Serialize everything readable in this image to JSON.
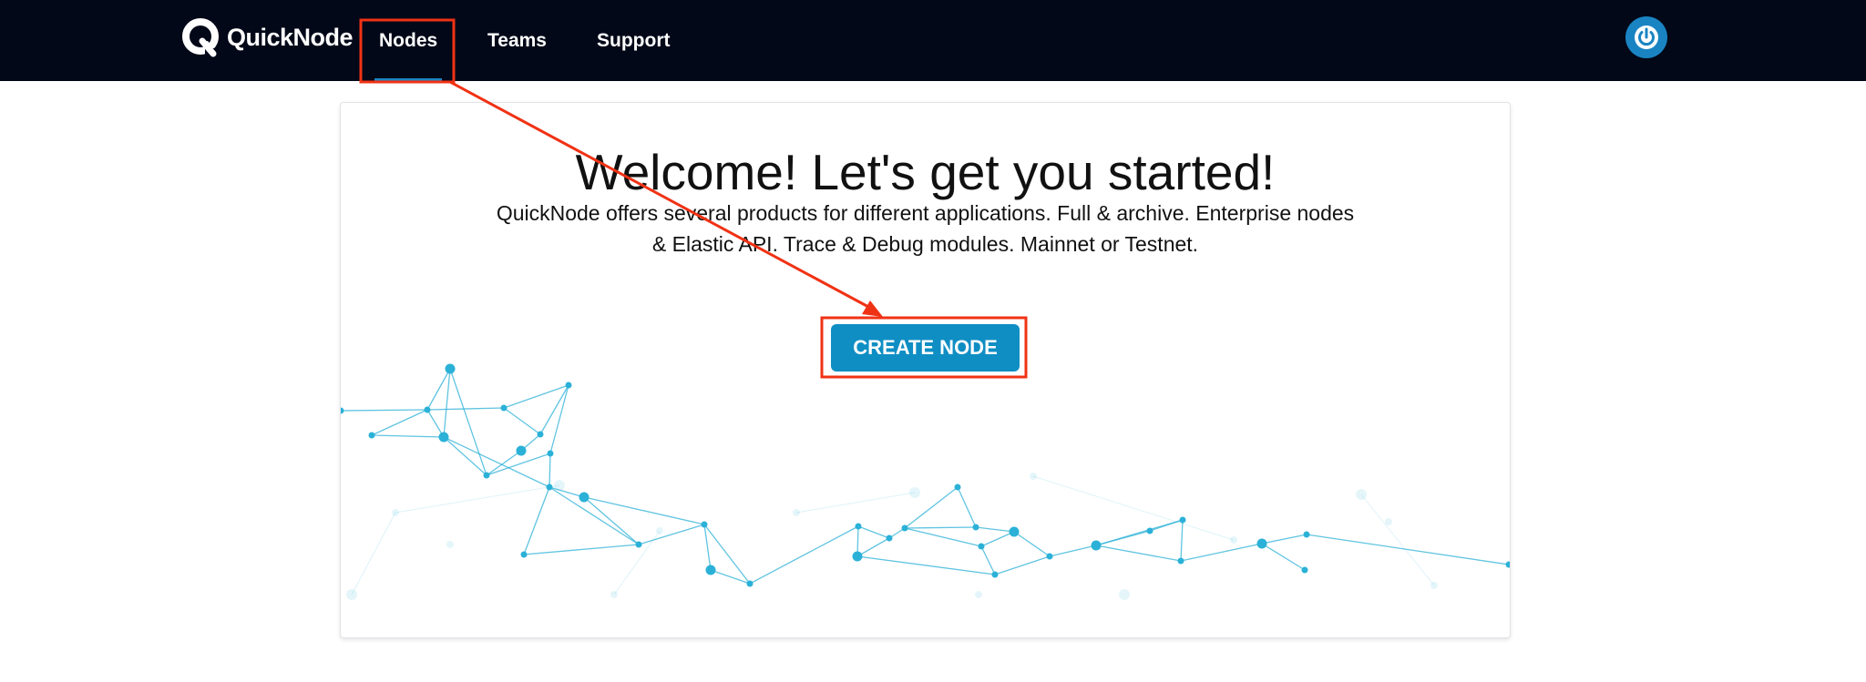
{
  "header": {
    "brand": "QuickNode",
    "nav": [
      {
        "label": "Nodes",
        "active": true
      },
      {
        "label": "Teams"
      },
      {
        "label": "Support"
      }
    ]
  },
  "main": {
    "title": "Welcome! Let's get you started!",
    "description": "QuickNode offers several products for different applications. Full & archive. Enterprise nodes & Elastic API. Trace & Debug modules. Mainnet or Testnet.",
    "cta_label": "CREATE NODE"
  },
  "colors": {
    "navbar_bg": "#020818",
    "accent": "#1a84c3",
    "cta_bg": "#0f8ec4",
    "annotation": "#f03214",
    "network": "#2bb1d7"
  },
  "icons": {
    "logo": "quicknode-q-logo-icon",
    "power": "power-icon"
  }
}
